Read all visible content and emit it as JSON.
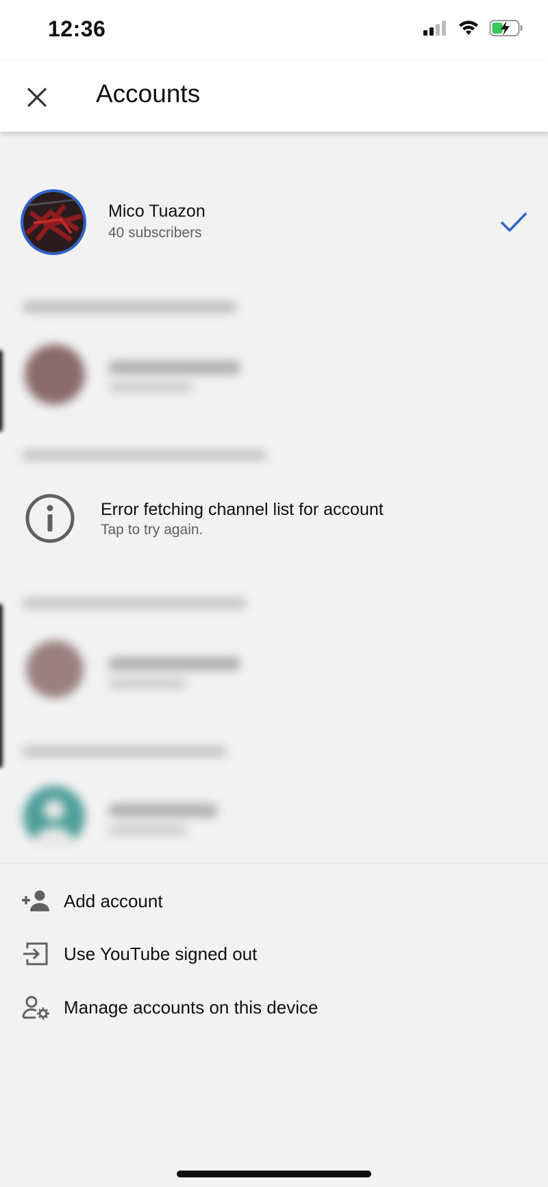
{
  "status_bar": {
    "time": "12:36"
  },
  "header": {
    "title": "Accounts",
    "close_icon": "close-icon"
  },
  "current_account": {
    "name": "Mico Tuazon",
    "subscribers": "40 subscribers",
    "selected_icon": "checkmark-icon",
    "accent_color": "#2e62c9"
  },
  "error_item": {
    "title": "Error fetching channel list for account",
    "subtitle": "Tap to try again.",
    "icon": "info-icon"
  },
  "actions": [
    {
      "label": "Add account",
      "icon": "add-person-icon"
    },
    {
      "label": "Use YouTube signed out",
      "icon": "sign-out-icon"
    },
    {
      "label": "Manage accounts on this device",
      "icon": "manage-accounts-icon"
    }
  ]
}
